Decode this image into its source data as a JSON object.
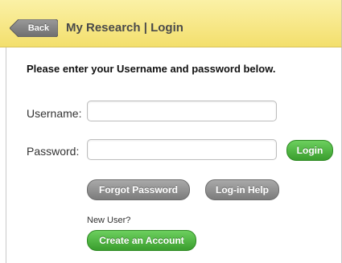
{
  "header": {
    "back_label": "Back",
    "title": "My Research | Login"
  },
  "form": {
    "instructions": "Please enter your Username and password below.",
    "username_label": "Username:",
    "username_value": "",
    "password_label": "Password:",
    "password_value": "",
    "login_label": "Login",
    "forgot_label": "Forgot Password",
    "help_label": "Log-in Help",
    "new_user_label": "New User?",
    "create_label": "Create an Account"
  },
  "colors": {
    "header_bg": "#f3df6d",
    "accent_green": "#3a9e2e",
    "secondary_gray": "#7c7c7c"
  }
}
